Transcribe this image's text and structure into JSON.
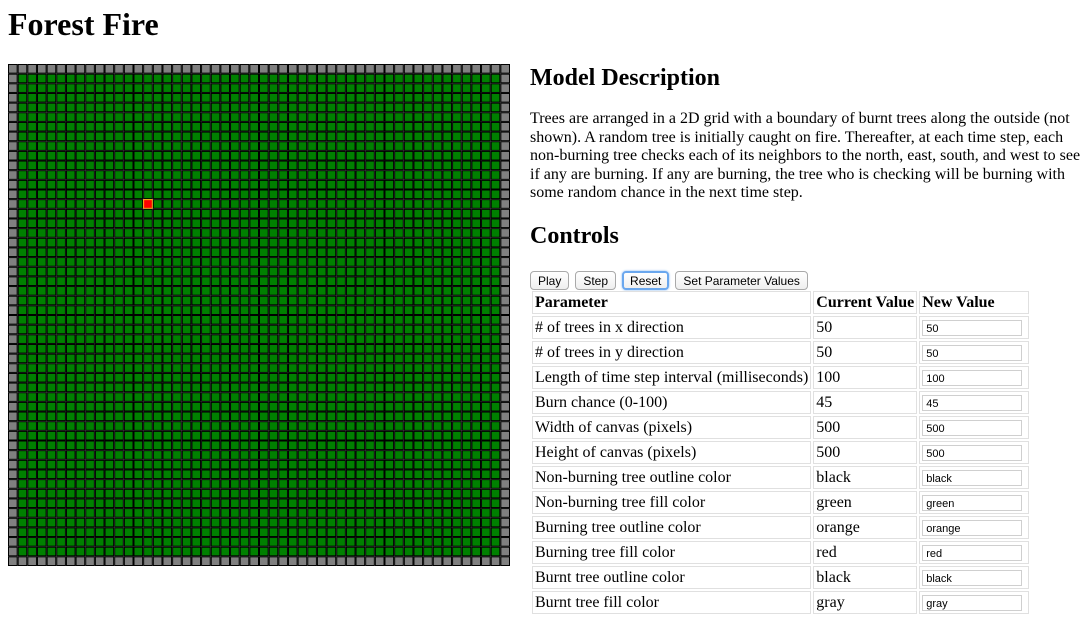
{
  "title": "Forest Fire",
  "grid": {
    "cols": 50,
    "rows": 50,
    "burning_cells": [
      [
        14,
        14
      ]
    ],
    "colors": {
      "tree_fill": "#008000",
      "tree_outline": "#000000",
      "burning_fill": "#ff0000",
      "burning_outline": "#ffa500",
      "burnt_fill": "#808080",
      "burnt_outline": "#000000"
    }
  },
  "description": {
    "heading": "Model Description",
    "text": "Trees are arranged in a 2D grid with a boundary of burnt trees along the outside (not shown). A random tree is initially caught on fire. Thereafter, at each time step, each non-burning tree checks each of its neighbors to the north, east, south, and west to see if any are burning. If any are burning, the tree who is checking will be burning with some random chance in the next time step."
  },
  "controls": {
    "heading": "Controls",
    "buttons": {
      "play": "Play",
      "step": "Step",
      "reset": "Reset",
      "set": "Set Parameter Values"
    },
    "table": {
      "headers": [
        "Parameter",
        "Current Value",
        "New Value"
      ],
      "rows": [
        {
          "param": "# of trees in x direction",
          "current": "50",
          "new": "50"
        },
        {
          "param": "# of trees in y direction",
          "current": "50",
          "new": "50"
        },
        {
          "param": "Length of time step interval (milliseconds)",
          "current": "100",
          "new": "100"
        },
        {
          "param": "Burn chance (0-100)",
          "current": "45",
          "new": "45"
        },
        {
          "param": "Width of canvas (pixels)",
          "current": "500",
          "new": "500"
        },
        {
          "param": "Height of canvas (pixels)",
          "current": "500",
          "new": "500"
        },
        {
          "param": "Non-burning tree outline color",
          "current": "black",
          "new": "black"
        },
        {
          "param": "Non-burning tree fill color",
          "current": "green",
          "new": "green"
        },
        {
          "param": "Burning tree outline color",
          "current": "orange",
          "new": "orange"
        },
        {
          "param": "Burning tree fill color",
          "current": "red",
          "new": "red"
        },
        {
          "param": "Burnt tree outline color",
          "current": "black",
          "new": "black"
        },
        {
          "param": "Burnt tree fill color",
          "current": "gray",
          "new": "gray"
        }
      ]
    }
  }
}
